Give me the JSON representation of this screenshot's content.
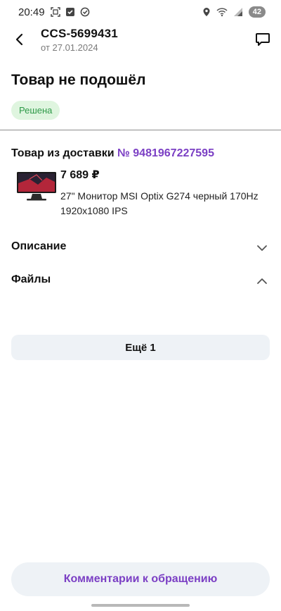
{
  "status_bar": {
    "time": "20:49",
    "battery": "42",
    "icons_left": [
      "screenshot-icon",
      "checkbox-icon",
      "check-circle-icon"
    ],
    "icons_right": [
      "location-icon",
      "wifi-icon",
      "signal-icon",
      "battery-icon"
    ]
  },
  "header": {
    "ticket_id": "CCS-5699431",
    "date": "от 27.01.2024",
    "back_icon": "arrow-left-icon",
    "chat_icon": "chat-icon"
  },
  "main": {
    "title": "Товар не подошёл",
    "status": "Решена",
    "status_color": "#2e9a48",
    "delivery_label": "Товар из доставки",
    "delivery_number": "№ 9481967227595",
    "product": {
      "price": "7 689 ₽",
      "name": "27\" Монитор MSI Optix G274 черный 170Hz 1920x1080 IPS"
    },
    "sections": [
      {
        "label": "Описание",
        "expanded": false
      },
      {
        "label": "Файлы",
        "expanded": true
      }
    ],
    "more_button": "Ещё 1"
  },
  "footer": {
    "comments_button": "Комментарии к обращению"
  },
  "colors": {
    "accent": "#7b3fc4",
    "badge_bg": "#dff5df",
    "button_bg": "#eef2f6"
  }
}
